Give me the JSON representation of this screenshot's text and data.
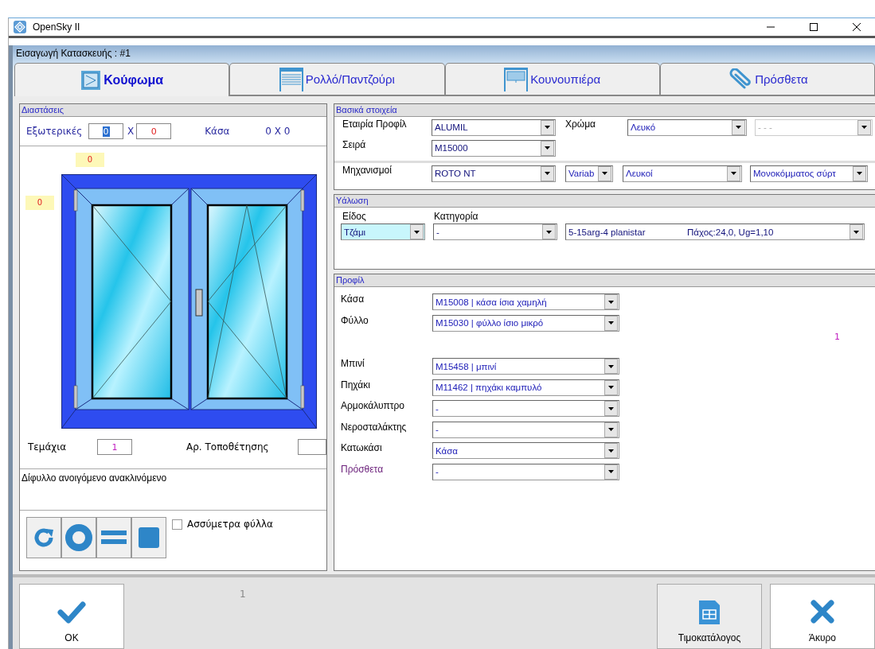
{
  "window": {
    "title": "OpenSky II"
  },
  "form_title": "Εισαγωγή Κατασκευής : #1",
  "tabs": [
    {
      "label": "Κούφωμα",
      "kind": "frame",
      "selected": true
    },
    {
      "label": "Ρολλό/Παντζούρι",
      "kind": "shutter",
      "selected": false
    },
    {
      "label": "Κουνουπιέρα",
      "kind": "screen",
      "selected": false
    },
    {
      "label": "Πρόσθετα",
      "kind": "clip",
      "selected": false
    }
  ],
  "dimensions": {
    "title": "Διαστάσεις",
    "outer_label": "Εξωτερικές",
    "width_value": "0",
    "x_label": "X",
    "height_value": "0",
    "frame_label": "Κάσα",
    "frame_value": "0 X 0",
    "top_value": "0",
    "side_value": "0",
    "pieces_label": "Τεμάχια",
    "pieces_value": "1",
    "position_label": "Αρ. Τοποθέτησης",
    "description": "Δίφυλλο ανοιγόμενο ανακλινόμενο",
    "tools": [
      {
        "kind": "rotate"
      },
      {
        "kind": "circle"
      },
      {
        "kind": "equals"
      },
      {
        "kind": "square"
      }
    ],
    "asymmetric": {
      "label": "Ασσύμετρα φύλλα",
      "checked": false
    }
  },
  "basic": {
    "title": "Βασικά στοιχεία",
    "company": {
      "label": "Εταιρία Προφίλ",
      "value": "ALUMIL"
    },
    "color": {
      "label": "Χρώμα",
      "value": "Λευκό",
      "extra": {
        "value": "- - -",
        "disabled": true
      }
    },
    "series": {
      "label": "Σειρά",
      "value": "M15000"
    },
    "mechanisms": {
      "label": "Μηχανισμοί",
      "values": [
        "ROTO NT",
        "Variab",
        "Λευκοί",
        "Μονοκόμματος σύρτ"
      ]
    }
  },
  "glazing": {
    "title": "Υάλωση",
    "type_label": "Είδος",
    "category_label": "Κατηγορία",
    "type": {
      "value": "Τζάμι",
      "focused": true
    },
    "category": "-",
    "glass": "5-15arg-4 planistar",
    "glass_info": "Πάχος:24,0, Ug=1,10"
  },
  "profiles": {
    "title": "Προφίλ",
    "note": "1",
    "rows": [
      {
        "label": "Κάσα",
        "value": "M15008 | κάσα ίσια χαμηλή"
      },
      {
        "label": "Φύλλο",
        "value": "M15030 | φύλλο ίσιο μικρό"
      },
      {
        "label": "Μπινί",
        "value": "M15458 | μπινί"
      },
      {
        "label": "Πηχάκι",
        "value": "M11462 | πηχάκι καμπυλό"
      },
      {
        "label": "Αρμοκάλυπτρο",
        "value": "-"
      },
      {
        "label": "Νεροσταλάκτης",
        "value": "-"
      },
      {
        "label": "Κατωκάσι",
        "value": "Κάσα"
      },
      {
        "label": "Πρόσθετα",
        "value": "-"
      }
    ]
  },
  "footer": {
    "counter": "1",
    "buttons": [
      {
        "label": "OK",
        "kind": "ok"
      },
      {
        "label": "Τιμοκατάλογος",
        "kind": "pricelist"
      },
      {
        "label": "Άκυρο",
        "kind": "cancel"
      }
    ]
  }
}
